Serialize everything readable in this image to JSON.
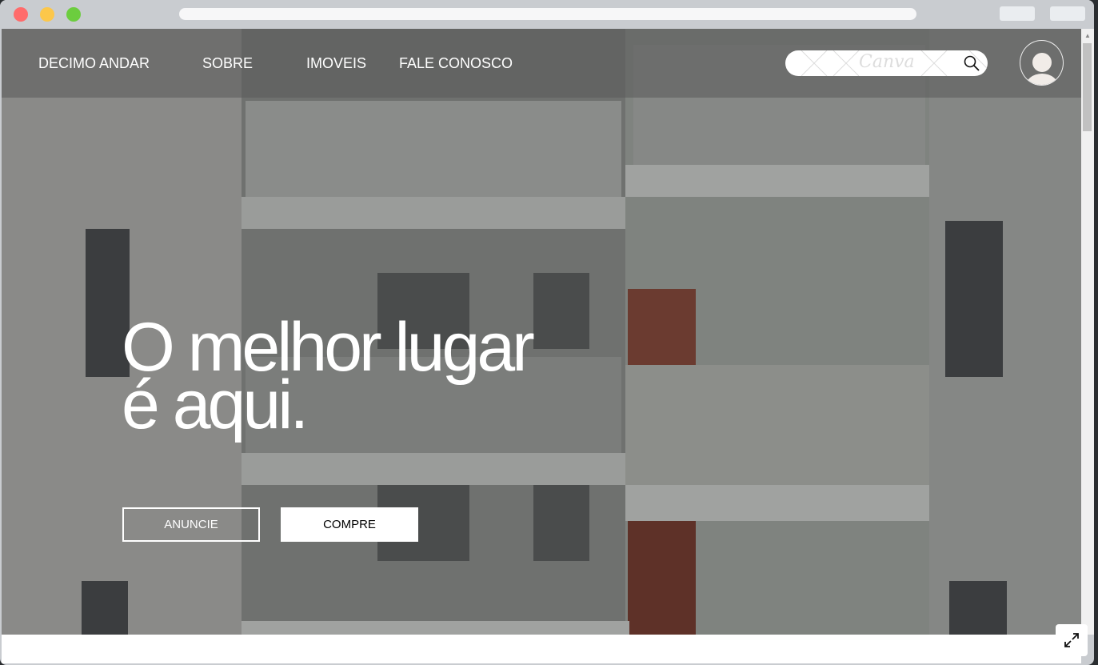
{
  "nav": {
    "brand": "DECIMO ANDAR",
    "links": [
      "SOBRE",
      "IMOVEIS",
      "FALE CONOSCO"
    ]
  },
  "search": {
    "watermark": "Canva",
    "icon": "search-icon"
  },
  "hero": {
    "line1": "O melhor lugar",
    "line2": "é aqui."
  },
  "buttons": {
    "anuncie": "ANUNCIE",
    "compre": "COMPRE"
  },
  "colors": {
    "close": "#fe5f57",
    "minimize": "#febc2e",
    "maximize": "#28c840"
  }
}
